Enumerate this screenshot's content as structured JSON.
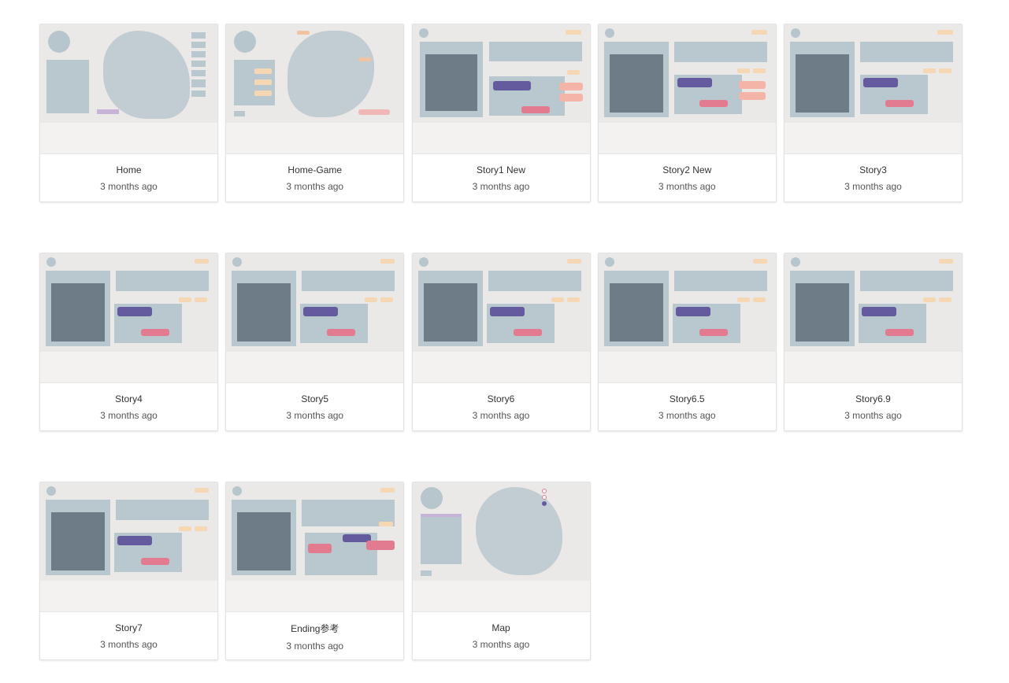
{
  "projects": [
    {
      "title": "Home",
      "time": "3 months ago",
      "variant": "home"
    },
    {
      "title": "Home-Game",
      "time": "3 months ago",
      "variant": "homegame"
    },
    {
      "title": "Story1 New",
      "time": "3 months ago",
      "variant": "story1"
    },
    {
      "title": "Story2 New",
      "time": "3 months ago",
      "variant": "story"
    },
    {
      "title": "Story3",
      "time": "3 months ago",
      "variant": "story"
    },
    {
      "title": "Story4",
      "time": "3 months ago",
      "variant": "story"
    },
    {
      "title": "Story5",
      "time": "3 months ago",
      "variant": "story"
    },
    {
      "title": "Story6",
      "time": "3 months ago",
      "variant": "story"
    },
    {
      "title": "Story6.5",
      "time": "3 months ago",
      "variant": "story"
    },
    {
      "title": "Story6.9",
      "time": "3 months ago",
      "variant": "story"
    },
    {
      "title": "Story7",
      "time": "3 months ago",
      "variant": "story"
    },
    {
      "title": "Ending参考",
      "time": "3 months ago",
      "variant": "ending"
    },
    {
      "title": "Map",
      "time": "3 months ago",
      "variant": "map"
    }
  ]
}
